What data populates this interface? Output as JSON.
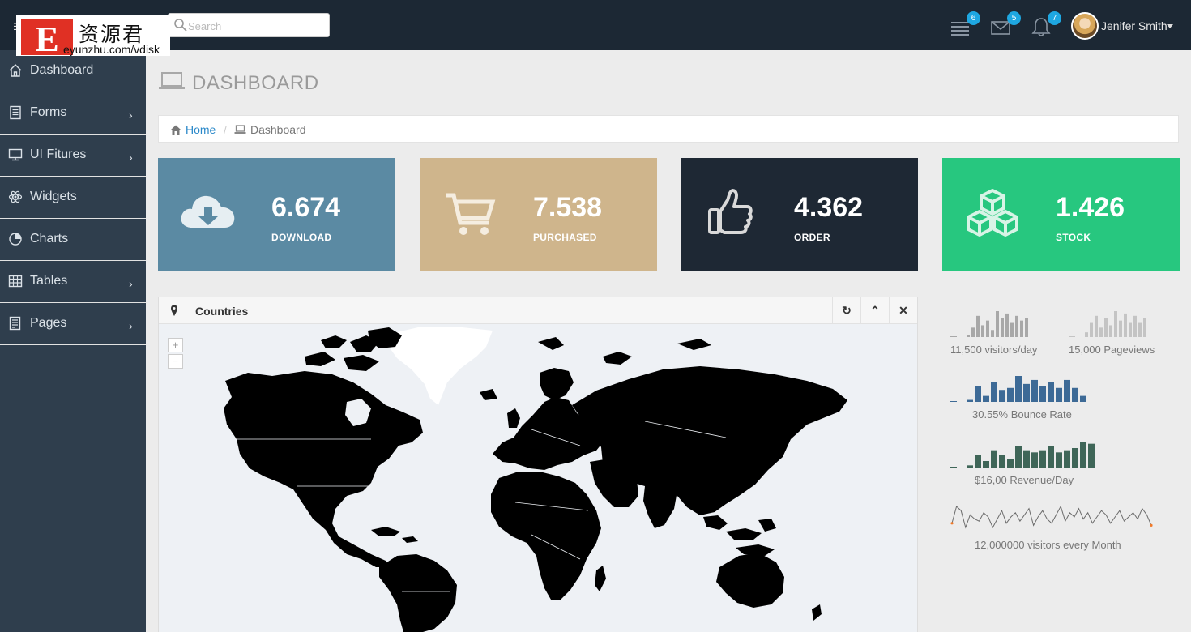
{
  "topbar": {
    "logo_cn": "资源君",
    "logo_url": "eyunzhu.com/vdisk",
    "search_placeholder": "Search",
    "messages_count": "6",
    "mail_count": "5",
    "notifications_count": "7",
    "user_name": "Jenifer Smith"
  },
  "sidebar": {
    "items": [
      {
        "label": "Dashboard",
        "icon": "home-icon"
      },
      {
        "label": "Forms",
        "icon": "forms-icon"
      },
      {
        "label": "UI Fitures",
        "icon": "monitor-icon"
      },
      {
        "label": "Widgets",
        "icon": "atom-icon"
      },
      {
        "label": "Charts",
        "icon": "pie-chart-icon"
      },
      {
        "label": "Tables",
        "icon": "table-icon"
      },
      {
        "label": "Pages",
        "icon": "pages-icon"
      }
    ]
  },
  "page": {
    "title": "DASHBOARD",
    "breadcrumb_home": "Home",
    "breadcrumb_current": "Dashboard"
  },
  "stats": [
    {
      "value": "6.674",
      "label": "DOWNLOAD",
      "color": "#5b8aa3",
      "icon": "cloud-download-icon"
    },
    {
      "value": "7.538",
      "label": "PURCHASED",
      "color": "#cfb58c",
      "icon": "cart-icon"
    },
    {
      "value": "4.362",
      "label": "ORDER",
      "color": "#1e2834",
      "icon": "thumbs-up-icon"
    },
    {
      "value": "1.426",
      "label": "STOCK",
      "color": "#27c77f",
      "icon": "cubes-icon"
    }
  ],
  "map_panel": {
    "title": "Countries",
    "zoom_in": "+",
    "zoom_out": "−"
  },
  "sparklines": {
    "visitors_label": "11,500 visitors/day",
    "pageviews_label": "15,000 Pageviews",
    "bounce_label": "30.55% Bounce Rate",
    "revenue_label": "$16,00 Revenue/Day",
    "monthly_label": "12,000000 visitors every Month",
    "visitors_bars": [
      1,
      4,
      9,
      5,
      7,
      3,
      11,
      8,
      10,
      6,
      9,
      7,
      8
    ],
    "pageviews_bars": [
      2,
      6,
      9,
      4,
      8,
      5,
      11,
      7,
      10,
      6,
      9,
      6,
      8
    ],
    "bounce_bars": [
      1,
      8,
      3,
      10,
      6,
      7,
      13,
      9,
      11,
      8,
      10,
      7,
      11,
      7,
      3
    ],
    "revenue_bars": [
      1,
      6,
      3,
      8,
      6,
      4,
      10,
      8,
      7,
      8,
      10,
      7,
      8,
      9,
      12,
      11
    ],
    "monthly_line": [
      6,
      14,
      12,
      4,
      10,
      8,
      7,
      11,
      9,
      4,
      8,
      12,
      6,
      9,
      11,
      7,
      10,
      13,
      5,
      9,
      12,
      8,
      6,
      10,
      14,
      7,
      11,
      9,
      13,
      8,
      11,
      6,
      9,
      12,
      10,
      6,
      9,
      12,
      7,
      9,
      11,
      8,
      13,
      10,
      5
    ]
  }
}
